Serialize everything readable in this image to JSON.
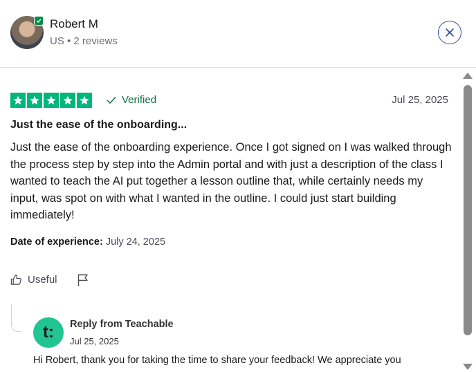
{
  "reviewer": {
    "name": "Robert M",
    "meta": "US • 2 reviews"
  },
  "review": {
    "rating": 5,
    "verified_label": "Verified",
    "date": "Jul 25, 2025",
    "title": "Just the ease of the onboarding...",
    "body": "Just the ease of the onboarding experience. Once I got signed on I was walked through the process step by step into the Admin portal and with just a description of the class I wanted to teach the AI put together a lesson outline that, while certainly needs my input, was spot on with what I wanted in the outline. I could just start building immediately!",
    "experience_label": "Date of experience:",
    "experience_date": "July 24, 2025",
    "useful_label": "Useful"
  },
  "reply": {
    "logo_text": "t:",
    "from": "Reply from Teachable",
    "date": "Jul 25, 2025",
    "text": "Hi Robert, thank you for taking the time to share your feedback! We appreciate you"
  },
  "colors": {
    "star_green": "#00b67a",
    "verified_green": "#0f6e40",
    "close_blue": "#2c4ba3",
    "reply_logo": "#22c48f"
  }
}
